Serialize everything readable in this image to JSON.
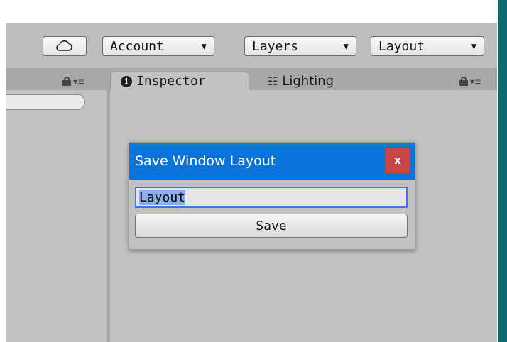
{
  "toolbar": {
    "cloud_icon": "cloud-icon",
    "account_label": "Account",
    "layers_label": "Layers",
    "layout_label": "Layout",
    "dropdown_icon": "caret-down-icon"
  },
  "left_panel": {
    "lock_icon": "lock-icon",
    "menu_icon": "menu-icon"
  },
  "right_panel": {
    "tabs": [
      {
        "label": "Inspector",
        "icon": "info-icon",
        "active": true
      },
      {
        "label": "Lighting",
        "icon": "sliders-icon",
        "active": false
      }
    ],
    "lock_icon": "lock-icon",
    "menu_icon": "menu-icon"
  },
  "dialog": {
    "title": "Save Window Layout",
    "close_label": "x",
    "input_value": "Layout",
    "save_label": "Save"
  },
  "colors": {
    "dialog_titlebar": "#0a74da",
    "close_button": "#c94545",
    "panel_bg": "#c2c2c2",
    "accent_bar": "#0b6b6e"
  }
}
